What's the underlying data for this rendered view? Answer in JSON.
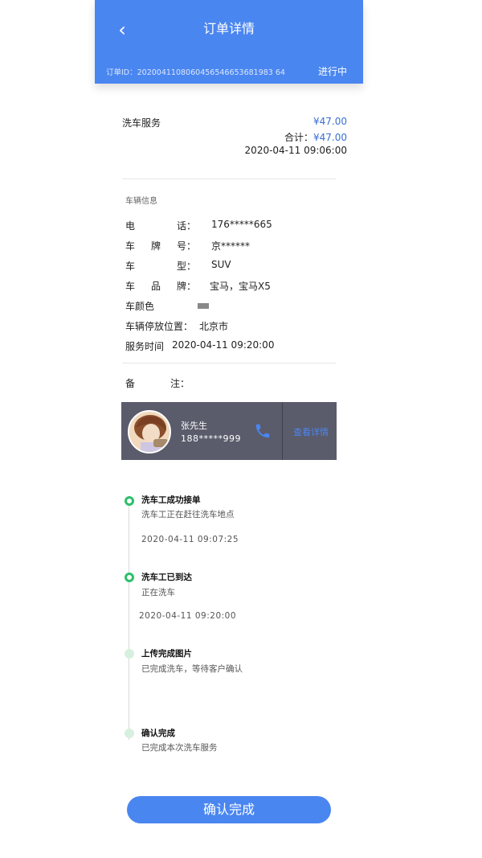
{
  "header": {
    "back_icon": "chevron-left-icon",
    "title": "订单详情",
    "order_id": "订单ID：2020041108060456546653681983 64",
    "status": "进行中"
  },
  "service": {
    "name": "洗车服务",
    "price": "¥47.00",
    "total_label": "合计：",
    "total_value": "¥47.00",
    "time": "2020-04-11 09:06:00"
  },
  "vehicle": {
    "section_title": "车辆信息",
    "phone_chars": [
      "电",
      "话："
    ],
    "phone": "176*****665",
    "plate_chars": [
      "车",
      "牌",
      "号："
    ],
    "plate": "京******",
    "type_chars": [
      "车",
      "型："
    ],
    "type": "SUV",
    "brand_chars": [
      "车",
      "品",
      "牌："
    ],
    "brand": "宝马，宝马X5",
    "color_label": "车颜色",
    "color_swatch": "#888888",
    "location_label": "车辆停放位置：",
    "location": "北京市",
    "service_time_label": "服务时间",
    "service_time": "2020-04-11 09:20:00",
    "remark_chars": [
      "备",
      "注："
    ]
  },
  "worker": {
    "name": "张先生",
    "phone": "188*****999",
    "phone_icon": "phone-icon",
    "detail_label": "查看详情"
  },
  "timeline": [
    {
      "title": "洗车工成功接单",
      "desc": "洗车工正在赶往洗车地点",
      "time": "2020-04-11 09:07:25",
      "state": "done"
    },
    {
      "title": "洗车工已到达",
      "desc": "正在洗车",
      "time": "2020-04-11 09:20:00",
      "state": "done"
    },
    {
      "title": "上传完成图片",
      "desc": "已完成洗车，等待客户确认",
      "time": "",
      "state": "pending"
    },
    {
      "title": "确认完成",
      "desc": "已完成本次洗车服务",
      "time": "",
      "state": "pending"
    }
  ],
  "confirm_button": "确认完成",
  "colors": {
    "primary": "#4a86f0",
    "success": "#2dbf6b",
    "card": "#5a5b6b"
  }
}
